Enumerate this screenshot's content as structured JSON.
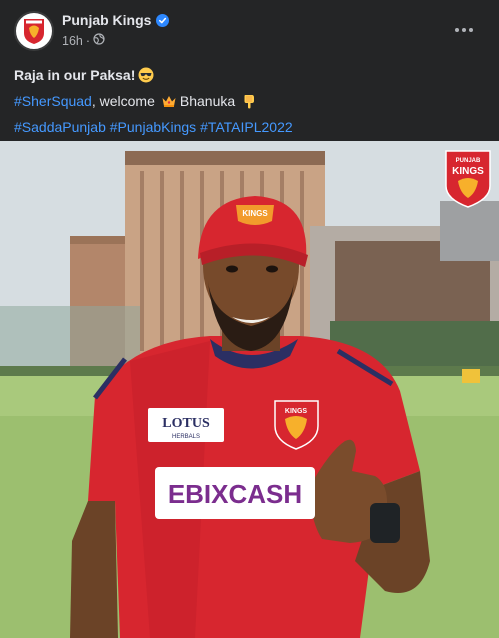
{
  "post": {
    "page_name": "Punjab Kings",
    "time": "16h",
    "separator": "·",
    "caption": {
      "line1_text": "Raja in our Paksa!",
      "line1_emoji": "smiling-face-with-sunglasses",
      "line2_hashtag": "#SherSquad",
      "line2_text": ", welcome",
      "line2_emoji1": "crown",
      "line2_name": "Bhanuka",
      "line2_emoji2": "backhand-index-pointing-down",
      "line3_hashtags": [
        "#SaddaPunjab",
        "#PunjabKings",
        "#TATAIPL2022"
      ]
    }
  },
  "photo": {
    "logo_top": "PUNJAB",
    "logo_bottom": "KINGS",
    "jersey_kings": "KINGS",
    "sponsor_lotus": "LOTUS",
    "sponsor_herbals": "HERBALS",
    "sponsor_main": "EBIXCASH"
  },
  "colors": {
    "background": "#242526",
    "text": "#e4e6eb",
    "secondary_text": "#b0b3b8",
    "link": "#4599ff",
    "verified": "#2d88ff",
    "brand_red": "#d7262f"
  }
}
